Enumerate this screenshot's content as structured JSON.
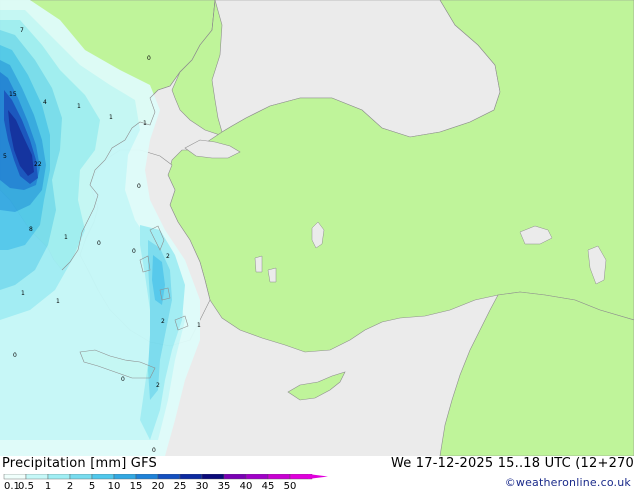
{
  "title": {
    "left": "Precipitation [mm] GFS",
    "right": "We 17-12-2025 15..18 UTC (12+270"
  },
  "credit": "©weatheronline.co.uk",
  "legend": {
    "labels": [
      "0.1",
      "0.5",
      "1",
      "2",
      "5",
      "10",
      "15",
      "20",
      "25",
      "30",
      "35",
      "40",
      "45",
      "50"
    ],
    "colors": [
      "#f0fffc",
      "#c6f8f8",
      "#a0eef4",
      "#78dcef",
      "#50c8ec",
      "#32a8e2",
      "#1e82d8",
      "#1450c0",
      "#0c2aa0",
      "#0a0a7a",
      "#7a00b4",
      "#a000c8",
      "#c800d2",
      "#e000dc"
    ]
  },
  "colors": {
    "land": "#bff49a",
    "sea": "#ebebeb",
    "border": "#8e8e8e"
  },
  "values": [
    {
      "text": "7"
    },
    {
      "text": "15"
    },
    {
      "text": "4"
    },
    {
      "text": "5"
    },
    {
      "text": "22"
    },
    {
      "text": "8"
    },
    {
      "text": "1"
    },
    {
      "text": "1"
    },
    {
      "text": "1"
    },
    {
      "text": "1"
    },
    {
      "text": "0"
    },
    {
      "text": "1"
    },
    {
      "text": "0"
    },
    {
      "text": "0"
    },
    {
      "text": "0"
    },
    {
      "text": "2"
    },
    {
      "text": "1"
    },
    {
      "text": "2"
    },
    {
      "text": "1"
    },
    {
      "text": "0"
    },
    {
      "text": "0"
    },
    {
      "text": "2"
    },
    {
      "text": "0"
    }
  ]
}
